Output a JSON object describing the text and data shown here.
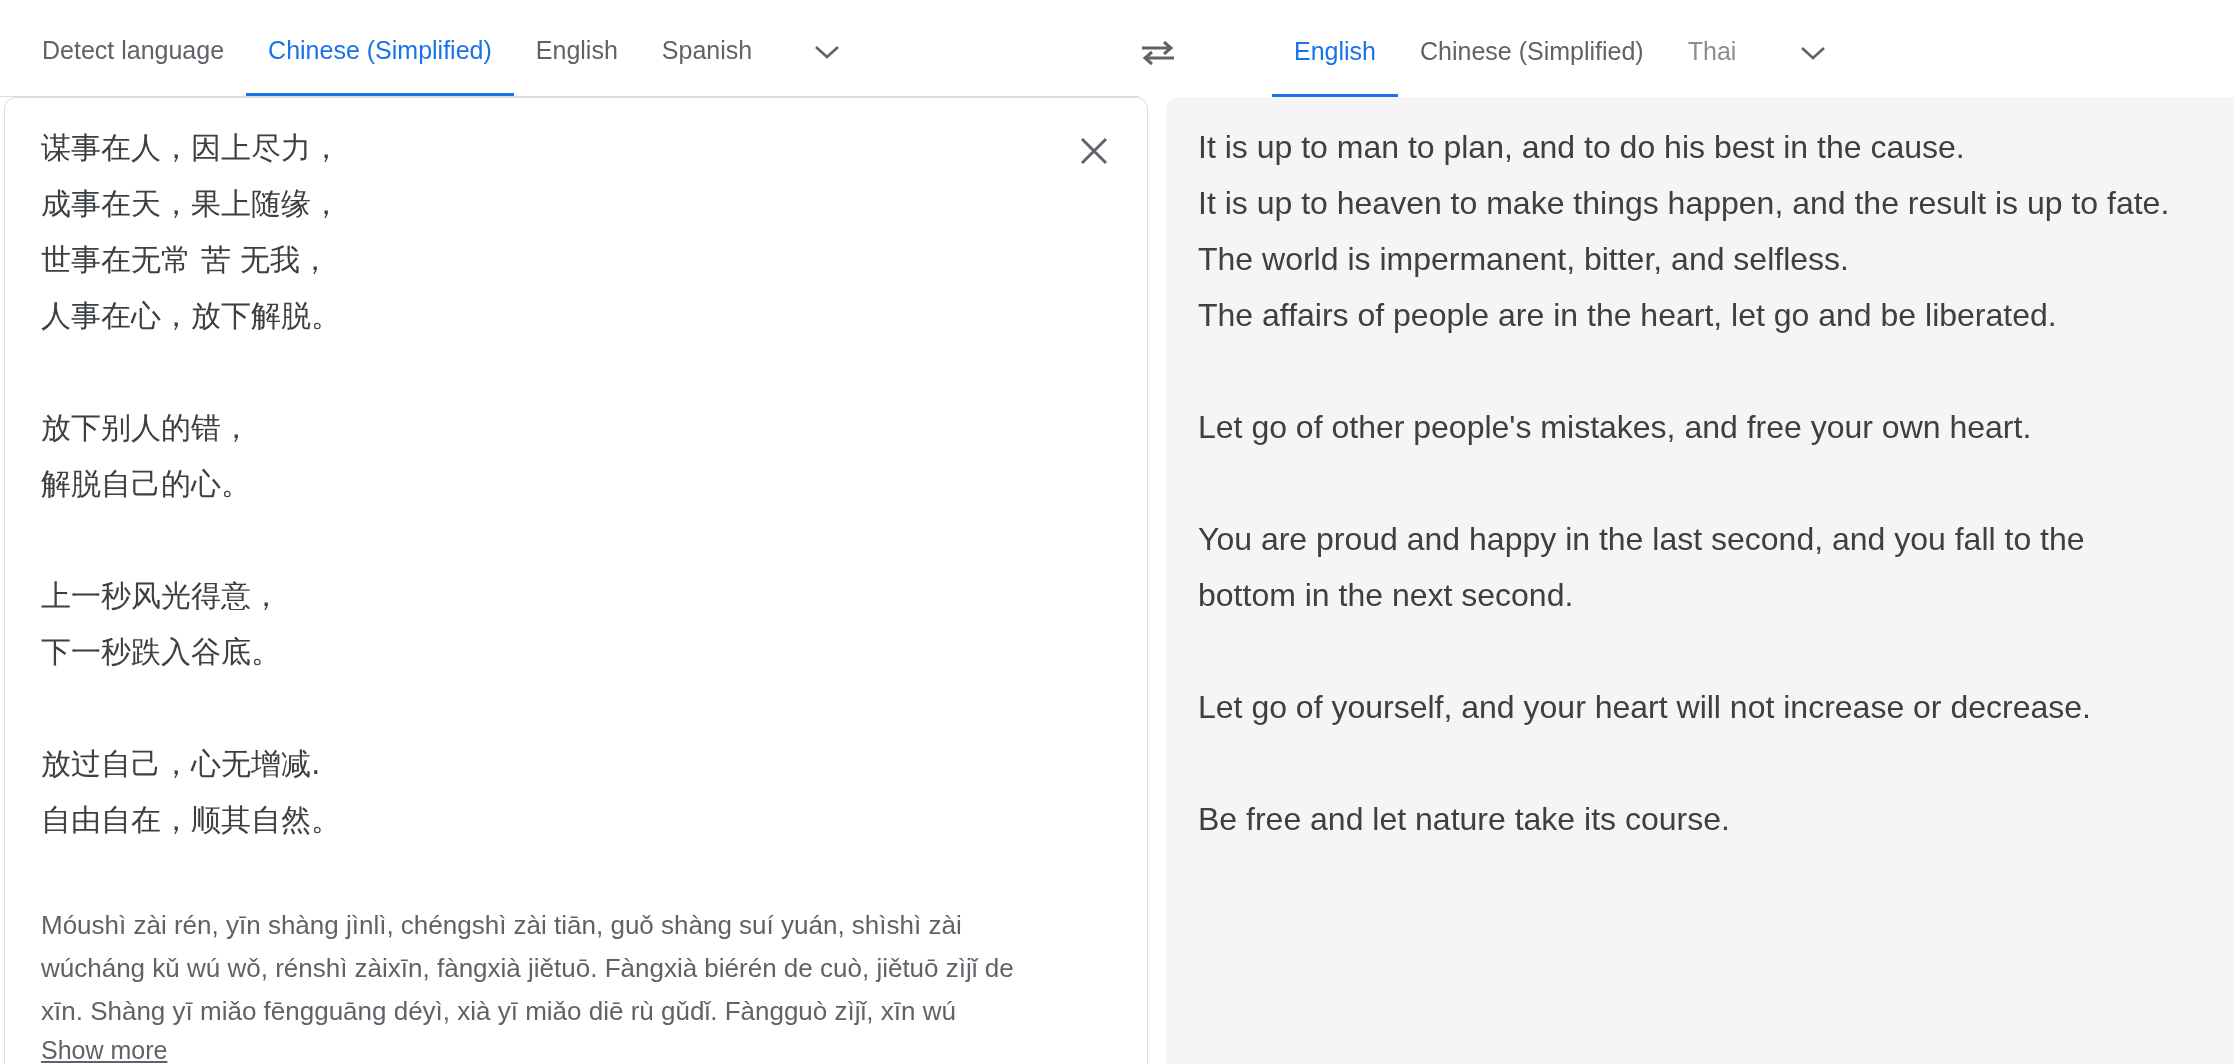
{
  "source_tabs": [
    {
      "label": "Detect language",
      "selected": false
    },
    {
      "label": "Chinese (Simplified)",
      "selected": true
    },
    {
      "label": "English",
      "selected": false
    },
    {
      "label": "Spanish",
      "selected": false
    }
  ],
  "target_tabs": [
    {
      "label": "English",
      "selected": true
    },
    {
      "label": "Chinese (Simplified)",
      "selected": false
    },
    {
      "label": "Thai",
      "selected": false
    }
  ],
  "source_text": [
    [
      "谋事在人，因上尽力，",
      "成事在天，果上随缘，",
      "世事在无常 苦 无我，",
      "人事在心，放下解脱。"
    ],
    [
      "放下别人的错，",
      "解脱自己的心。"
    ],
    [
      "上一秒风光得意，",
      "下一秒跌入谷底。"
    ],
    [
      "放过自己，心无增减.",
      "自由自在，顺其自然。"
    ]
  ],
  "transliteration": "Móushì zài rén, yīn shàng jìnlì, chéngshì zài tiān, guǒ shàng suí yuán, shìshì zài wúcháng kǔ wú wǒ, rénshì zàixīn, fàngxià jiětuō. Fàngxià biérén de cuò, jiětuō zìjǐ de xīn. Shàng yī miǎo fēngguāng déyì, xià yī miǎo diē rù gǔdǐ. Fàngguò zìjǐ, xīn wú",
  "show_more": "Show more",
  "translation": [
    [
      "It is up to man to plan, and to do his best in the cause.",
      "It is up to heaven to make things happen, and the result is up to fate.",
      "The world is impermanent, bitter, and selfless.",
      "The affairs of people are in the heart, let go and be liberated."
    ],
    [
      "Let go of other people's mistakes, and free your own heart."
    ],
    [
      "You are proud and happy in the last second, and you fall to the bottom in the next second."
    ],
    [
      "Let go of yourself, and your heart will not increase or decrease."
    ],
    [
      "Be free and let nature take its course."
    ]
  ]
}
